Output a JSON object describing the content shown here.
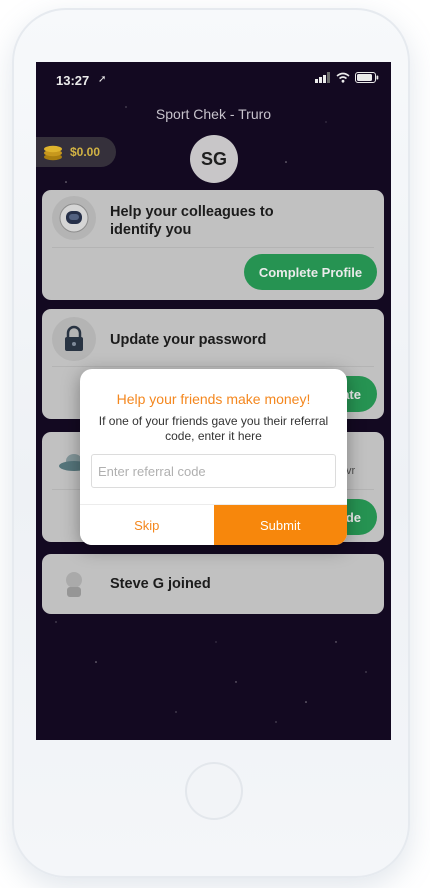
{
  "status_bar": {
    "time": "13:27"
  },
  "header": {
    "store_name": "Sport Chek - Truro",
    "balance": "$0.00",
    "avatar_initials": "SG"
  },
  "cards": {
    "profile": {
      "title": "Help your colleagues to identify you",
      "button": "Complete Profile"
    },
    "password": {
      "title": "Update your password",
      "button_partial": "ate"
    },
    "referral_card": {
      "text_partial": "vr",
      "button_partial": "de"
    },
    "joined": {
      "title": "Steve G joined"
    }
  },
  "modal": {
    "title": "Help your friends make money!",
    "body": "If one of your friends gave you their referral code, enter it here",
    "input_placeholder": "Enter referral code",
    "skip_label": "Skip",
    "submit_label": "Submit"
  },
  "colors": {
    "screen_bg": "#150a24",
    "card_bg": "#d2d2d2",
    "green": "#2aa05a",
    "orange": "#f7870c",
    "gold": "#e3c24a"
  }
}
